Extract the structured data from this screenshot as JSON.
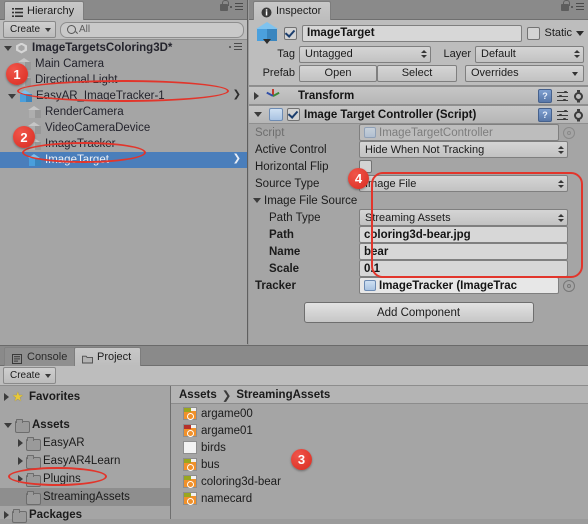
{
  "hierarchy": {
    "tab_label": "Hierarchy",
    "tab_icon": "hierarchy-icon",
    "create_label": "Create",
    "search_placeholder": "All",
    "search_value": "",
    "scene_name": "ImageTargetsColoring3D*",
    "items": [
      {
        "label": "Main Camera",
        "indent": 1,
        "disclosure": "none",
        "icon": "gameobject-cube-icon",
        "selected": false,
        "chevron": false
      },
      {
        "label": "Directional Light",
        "indent": 1,
        "disclosure": "none",
        "icon": "gameobject-cube-icon",
        "selected": false,
        "chevron": false
      },
      {
        "label": "EasyAR_ImageTracker-1",
        "indent": 1,
        "disclosure": "open",
        "icon": "prefab-cube-icon",
        "selected": false,
        "chevron": true
      },
      {
        "label": "RenderCamera",
        "indent": 2,
        "disclosure": "none",
        "icon": "gameobject-cube-icon",
        "selected": false,
        "chevron": false
      },
      {
        "label": "VideoCameraDevice",
        "indent": 2,
        "disclosure": "none",
        "icon": "gameobject-cube-icon",
        "selected": false,
        "chevron": false
      },
      {
        "label": "ImageTracker",
        "indent": 2,
        "disclosure": "none",
        "icon": "gameobject-cube-icon",
        "selected": false,
        "chevron": false
      },
      {
        "label": "ImageTarget",
        "indent": 2,
        "disclosure": "none",
        "icon": "prefab-cube-icon",
        "selected": true,
        "chevron": true
      }
    ]
  },
  "inspector": {
    "tab_label": "Inspector",
    "tab_icon": "info-icon",
    "object_name": "ImageTarget",
    "object_enabled": true,
    "static_label": "Static",
    "static_checked": false,
    "tag_label": "Tag",
    "tag_value": "Untagged",
    "layer_label": "Layer",
    "layer_value": "Default",
    "prefab_label": "Prefab",
    "prefab_open": "Open",
    "prefab_select": "Select",
    "prefab_overrides": "Overrides",
    "components": [
      {
        "title": "Transform",
        "icon": "transform-axis-icon",
        "expanded": false,
        "has_checkbox": false
      },
      {
        "title": "Image Target Controller (Script)",
        "icon": "script-icon",
        "expanded": true,
        "has_checkbox": true,
        "checked": true
      }
    ],
    "properties": [
      {
        "label": "Script",
        "value": "ImageTargetController",
        "kind": "object-readonly",
        "indent": 0
      },
      {
        "label": "Active Control",
        "value": "Hide When Not Tracking",
        "kind": "popup",
        "indent": 0
      },
      {
        "label": "Horizontal Flip",
        "value": "",
        "kind": "checkbox",
        "indent": 0,
        "checked": false
      },
      {
        "label": "Source Type",
        "value": "Image File",
        "kind": "popup",
        "indent": 0
      },
      {
        "label": "Image File Source",
        "value": "",
        "kind": "foldout",
        "indent": 0
      },
      {
        "label": "Path Type",
        "value": "Streaming Assets",
        "kind": "popup",
        "indent": 1
      },
      {
        "label": "Path",
        "value": "coloring3d-bear.jpg",
        "kind": "text",
        "indent": 1
      },
      {
        "label": "Name",
        "value": "bear",
        "kind": "text",
        "indent": 1
      },
      {
        "label": "Scale",
        "value": "0.1",
        "kind": "text",
        "indent": 1
      },
      {
        "label": "Tracker",
        "value": "ImageTracker (ImageTrac",
        "kind": "object",
        "indent": 0
      }
    ],
    "add_component_label": "Add Component"
  },
  "project": {
    "tabs": [
      {
        "label": "Console",
        "icon": "console-icon",
        "active": false
      },
      {
        "label": "Project",
        "icon": "folder-icon",
        "active": true
      }
    ],
    "create_label": "Create",
    "breadcrumb": [
      "Assets",
      "StreamingAssets"
    ],
    "tree": [
      {
        "label": "Favorites",
        "indent": 0,
        "disclosure": "closed",
        "icon": "star-icon",
        "bold": true,
        "selected": false
      },
      {
        "label": "",
        "indent": 0,
        "disclosure": "none",
        "icon": "spacer",
        "bold": false,
        "selected": false
      },
      {
        "label": "Assets",
        "indent": 0,
        "disclosure": "open",
        "icon": "folder-icon",
        "bold": true,
        "selected": false
      },
      {
        "label": "EasyAR",
        "indent": 1,
        "disclosure": "closed",
        "icon": "folder-icon",
        "bold": false,
        "selected": false
      },
      {
        "label": "EasyAR4Learn",
        "indent": 1,
        "disclosure": "closed",
        "icon": "folder-icon",
        "bold": false,
        "selected": false
      },
      {
        "label": "Plugins",
        "indent": 1,
        "disclosure": "closed",
        "icon": "folder-icon",
        "bold": false,
        "selected": false
      },
      {
        "label": "StreamingAssets",
        "indent": 1,
        "disclosure": "none",
        "icon": "folder-icon",
        "bold": false,
        "selected": true
      },
      {
        "label": "Packages",
        "indent": 0,
        "disclosure": "closed",
        "icon": "folder-icon",
        "bold": true,
        "selected": false
      }
    ],
    "assets": [
      {
        "label": "argame00",
        "icon": "image-file-icon",
        "tag_color": "#9aa61f"
      },
      {
        "label": "argame01",
        "icon": "image-file-icon",
        "tag_color": "#b5302a"
      },
      {
        "label": "birds",
        "icon": "blank-file-icon",
        "tag_color": ""
      },
      {
        "label": "bus",
        "icon": "image-file-icon",
        "tag_color": "#9aa61f"
      },
      {
        "label": "coloring3d-bear",
        "icon": "image-file-icon",
        "tag_color": "#9aa61f"
      },
      {
        "label": "namecard",
        "icon": "image-file-icon",
        "tag_color": "#9aa61f"
      }
    ]
  },
  "annotations": {
    "accent_color": "#e2352b",
    "badges": [
      {
        "number": "1",
        "target": "hierarchy-row-easyar-imagetracker"
      },
      {
        "number": "2",
        "target": "hierarchy-row-imagetarget"
      },
      {
        "number": "3",
        "target": "asset-coloring3d-bear"
      },
      {
        "number": "4",
        "target": "inspector-source-type-field"
      }
    ]
  }
}
